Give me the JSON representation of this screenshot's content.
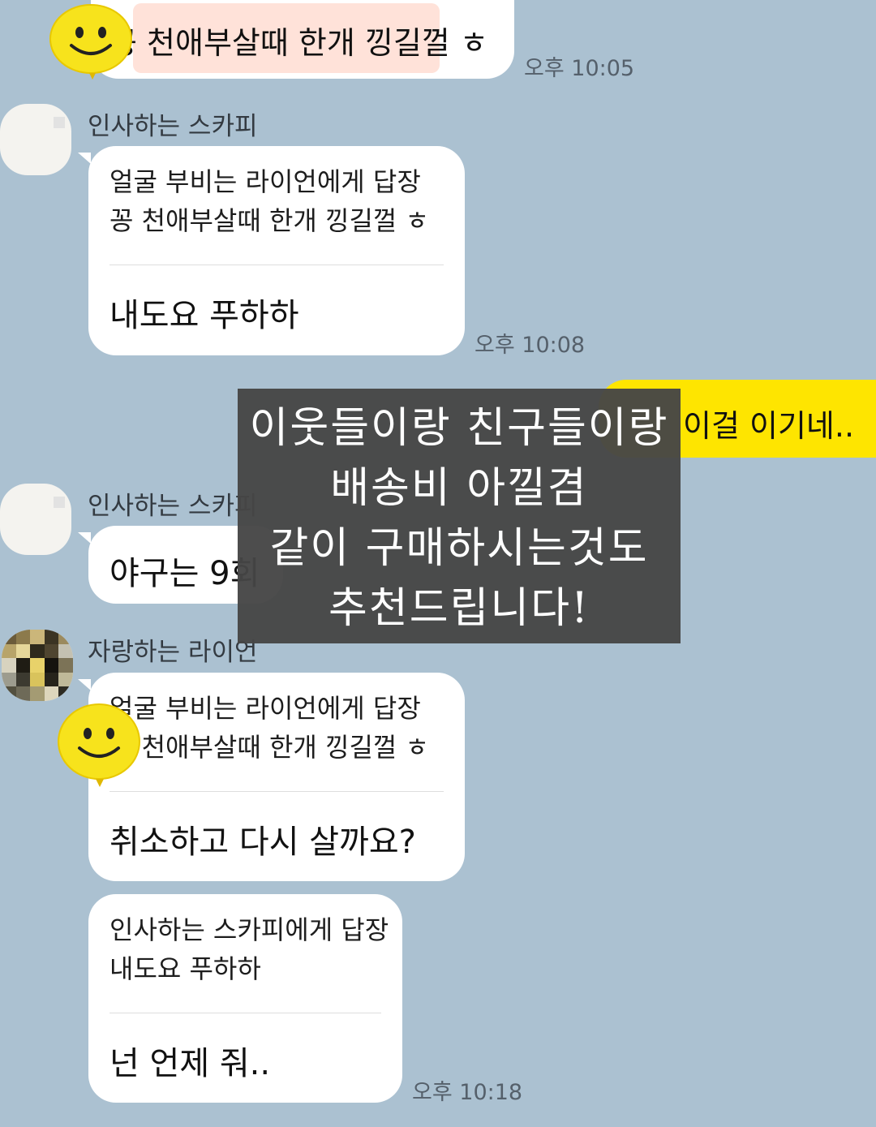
{
  "messages": {
    "m1": {
      "text": "꽁 천애부살때 한개 낑길껄 ㅎ",
      "time": "오후 10:05"
    },
    "m2": {
      "sender": "인사하는 스카피",
      "reply_to": "얼굴 부비는 라이언에게 답장",
      "quoted": "꽁 천애부살때 한개 낑길껄 ㅎ",
      "text": "내도요 푸하하",
      "time": "오후 10:08"
    },
    "m3": {
      "text": "이걸 이기네.."
    },
    "m4": {
      "sender": "인사하는 스카피",
      "text": "야구는 9회"
    },
    "m5": {
      "sender": "자랑하는 라이언",
      "reply_to": "얼굴 부비는 라이언에게 답장",
      "quoted": "꽁 천애부살때 한개 낑길껄 ㅎ",
      "text": "취소하고 다시 살까요?"
    },
    "m6": {
      "reply_to": "인사하는 스카피에게 답장",
      "quoted": "내도요 푸하하",
      "text": "넌 언제 줘..",
      "time": "오후 10:18"
    }
  },
  "caption": {
    "lines": [
      "이웃들이랑 친구들이랑",
      "배송비 아낄겸",
      "같이 구매하시는것도",
      "추천드립니다!"
    ]
  },
  "icons": {
    "sticker": "smiley-balloon-icon"
  },
  "colors": {
    "background": "#abc1d1",
    "my_bubble": "#fee500",
    "their_bubble": "#ffffff",
    "caption_box": "#464646"
  }
}
